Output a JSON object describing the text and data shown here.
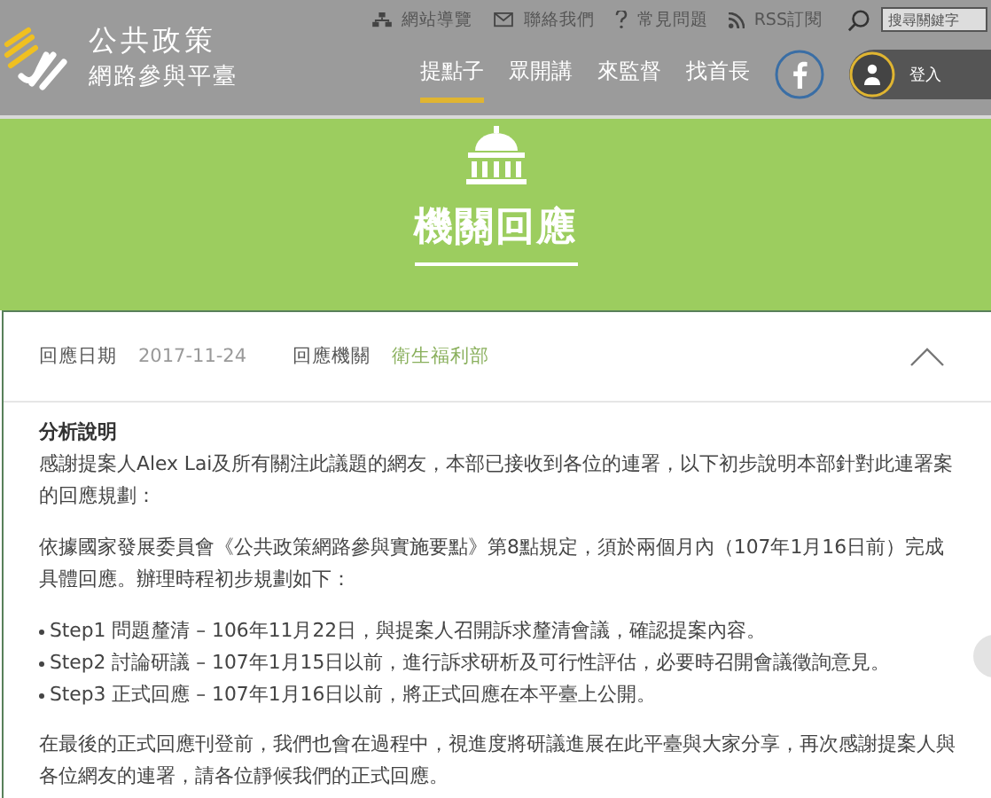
{
  "top_links": [
    {
      "label": "網站導覽"
    },
    {
      "label": "聯絡我們"
    },
    {
      "label": "常見問題"
    },
    {
      "label": "RSS訂閱"
    }
  ],
  "search": {
    "placeholder": "搜尋關鍵字"
  },
  "logo": {
    "line1": "公共政策",
    "line2": "網路參與平臺"
  },
  "nav": [
    {
      "label": "提點子",
      "selected": true
    },
    {
      "label": "眾開講",
      "selected": false
    },
    {
      "label": "來監督",
      "selected": false
    },
    {
      "label": "找首長",
      "selected": false
    }
  ],
  "login": {
    "label": "登入"
  },
  "banner": {
    "title": "機關回應"
  },
  "response": {
    "expanded": true,
    "date_label": "回應日期",
    "date": "2017-11-24",
    "agency_label": "回應機關",
    "agency": "衛生福利部",
    "heading": "分析說明",
    "paragraphs": [
      {
        "kind": "text",
        "text": "感謝提案人Alex Lai及所有關注此議題的網友，本部已接收到各位的連署，以下初步說明本部針對此連署案的回應規劃："
      },
      {
        "kind": "text",
        "text": "依據國家發展委員會《公共政策網路參與實施要點》第8點規定，須於兩個月內（107年1月16日前）完成具體回應。辦理時程初步規劃如下："
      },
      {
        "kind": "list",
        "items": [
          "Step1 問題釐清 – 106年11月22日，與提案人召開訴求釐清會議，確認提案內容。",
          "Step2 討論研議 – 107年1月15日以前，進行訴求研析及可行性評估，必要時召開會議徵詢意見。",
          "Step3 正式回應 – 107年1月16日以前，將正式回應在本平臺上公開。"
        ]
      },
      {
        "kind": "text",
        "text": "在最後的正式回應刊登前，我們也會在過程中，視進度將研議進展在此平臺與大家分享，再次感謝提案人與各位網友的連署，請各位靜候我們的正式回應。"
      }
    ]
  }
}
